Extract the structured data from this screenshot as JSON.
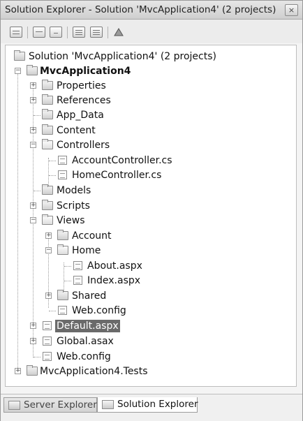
{
  "window": {
    "title": "Solution Explorer - Solution 'MvcApplication4' (2 projects)",
    "close_glyph": "×"
  },
  "toolbar": {
    "icons": [
      "properties-icon",
      "show-all-files-icon",
      "refresh-icon",
      "view-code-icon",
      "view-designer-icon",
      "class-diagram-icon"
    ]
  },
  "tree": {
    "solution": "Solution 'MvcApplication4' (2 projects)",
    "project": "MvcApplication4",
    "properties": "Properties",
    "references": "References",
    "app_data": "App_Data",
    "content": "Content",
    "controllers": "Controllers",
    "account_controller": "AccountController.cs",
    "home_controller": "HomeController.cs",
    "models": "Models",
    "scripts": "Scripts",
    "views": "Views",
    "account": "Account",
    "home": "Home",
    "about": "About.aspx",
    "index": "Index.aspx",
    "shared": "Shared",
    "views_web_config": "Web.config",
    "default": "Default.aspx",
    "global": "Global.asax",
    "web_config": "Web.config",
    "tests": "MvcApplication4.Tests"
  },
  "tabs": {
    "server_explorer": "Server Explorer",
    "solution_explorer": "Solution Explorer"
  },
  "expander": {
    "plus": "+",
    "minus": "−"
  }
}
